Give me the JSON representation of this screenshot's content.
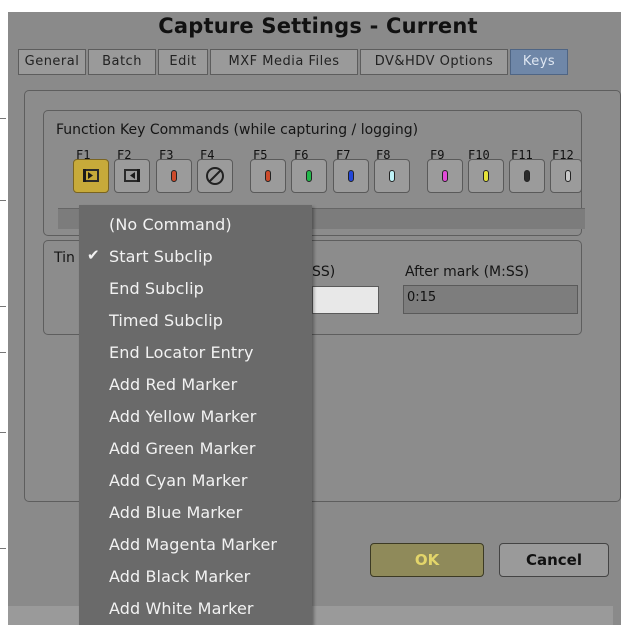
{
  "window": {
    "title": "Capture Settings - Current"
  },
  "tabs": [
    {
      "label": "General"
    },
    {
      "label": "Batch"
    },
    {
      "label": "Edit"
    },
    {
      "label": "MXF Media Files"
    },
    {
      "label": "DV&HDV Options"
    },
    {
      "label": "Keys"
    }
  ],
  "function_keys": {
    "group_title": "Function Key Commands (while capturing / logging)",
    "keys": [
      {
        "label": "F1",
        "icon": "start-subclip-icon",
        "marker_color": ""
      },
      {
        "label": "F2",
        "icon": "end-subclip-icon",
        "marker_color": ""
      },
      {
        "label": "F3",
        "icon": "red-marker-icon",
        "marker_color": "#cc4a2a"
      },
      {
        "label": "F4",
        "icon": "no-command-icon",
        "marker_color": ""
      },
      {
        "label": "F5",
        "icon": "red-marker-icon",
        "marker_color": "#cc4a2a"
      },
      {
        "label": "F6",
        "icon": "green-marker-icon",
        "marker_color": "#22b84a"
      },
      {
        "label": "F7",
        "icon": "blue-marker-icon",
        "marker_color": "#2246d8"
      },
      {
        "label": "F8",
        "icon": "cyan-marker-icon",
        "marker_color": "#bff3f7"
      },
      {
        "label": "F9",
        "icon": "magenta-marker-icon",
        "marker_color": "#e24ad8"
      },
      {
        "label": "F10",
        "icon": "yellow-marker-icon",
        "marker_color": "#e6e23a"
      },
      {
        "label": "F11",
        "icon": "black-marker-icon",
        "marker_color": "#2a2a2a"
      },
      {
        "label": "F12",
        "icon": "white-marker-icon",
        "marker_color": "#c8c8c8"
      }
    ]
  },
  "timed_subclip": {
    "group_title_visible": "Tin",
    "before_label_visible": "SS)",
    "before_value": "",
    "after_label": "After mark (M:SS)",
    "after_value": "0:15"
  },
  "buttons": {
    "ok": "OK",
    "cancel": "Cancel"
  },
  "command_menu": {
    "items": [
      {
        "label": "(No Command)",
        "checked": false
      },
      {
        "label": "Start Subclip",
        "checked": true
      },
      {
        "label": "End Subclip",
        "checked": false
      },
      {
        "label": "Timed Subclip",
        "checked": false
      },
      {
        "label": "End Locator Entry",
        "checked": false
      },
      {
        "label": "Add Red Marker",
        "checked": false
      },
      {
        "label": "Add Yellow Marker",
        "checked": false
      },
      {
        "label": "Add Green Marker",
        "checked": false
      },
      {
        "label": "Add Cyan Marker",
        "checked": false
      },
      {
        "label": "Add Blue Marker",
        "checked": false
      },
      {
        "label": "Add Magenta Marker",
        "checked": false
      },
      {
        "label": "Add Black Marker",
        "checked": false
      },
      {
        "label": "Add White Marker",
        "checked": false
      }
    ],
    "check_glyph": "✔"
  },
  "colors": {
    "active_tab": "#6f87a8",
    "selected_key": "#c7aa3a",
    "ok_button": "#8f8a5a",
    "menu_bg": "#6a6a6a"
  }
}
